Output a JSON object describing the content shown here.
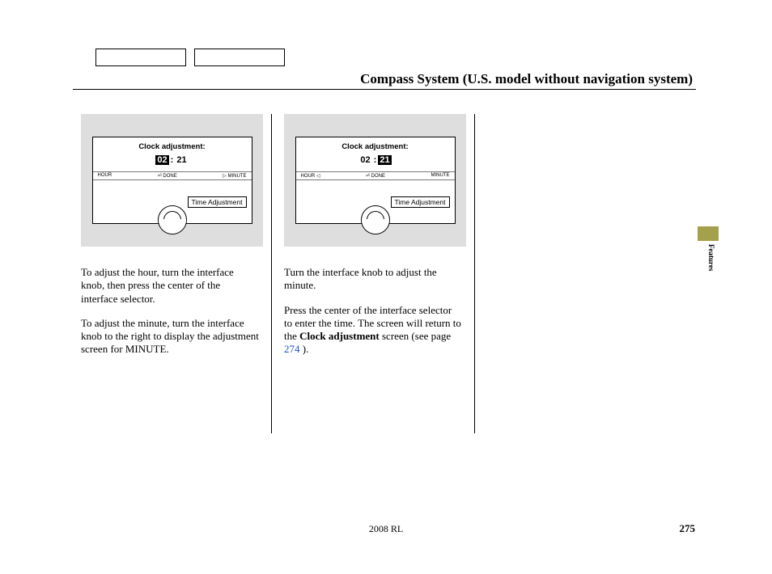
{
  "header": {
    "title": "Compass System (U.S. model without navigation system)"
  },
  "fig1": {
    "title": "Clock adjustment:",
    "hour": "02",
    "sep": ":",
    "minute": "21",
    "labelLeft": "HOUR",
    "labelMid": "⏎ DONE",
    "labelRight": "▷ MINUTE",
    "timeAdj": "Time Adjustment"
  },
  "fig2": {
    "title": "Clock adjustment:",
    "hour": "02",
    "sep": ":",
    "minute": "21",
    "labelLeft": "HOUR ◁",
    "labelMid": "⏎ DONE",
    "labelRight": "MINUTE",
    "timeAdj": "Time Adjustment"
  },
  "col1": {
    "p1": "To adjust the hour, turn the interface knob, then press the center of the interface selector.",
    "p2": "To adjust the minute, turn the interface knob to the right to display the adjustment screen for MINUTE."
  },
  "col2": {
    "p1": "Turn the interface knob to adjust the minute.",
    "p2a": "Press the center of the interface selector to enter the time. The screen will return to the ",
    "p2b": "Clock adjustment",
    "p2c": " screen (see page ",
    "p2link": "274",
    "p2d": " )."
  },
  "footer": {
    "model": "2008  RL",
    "pageNumber": "275",
    "sideTab": "Features"
  }
}
